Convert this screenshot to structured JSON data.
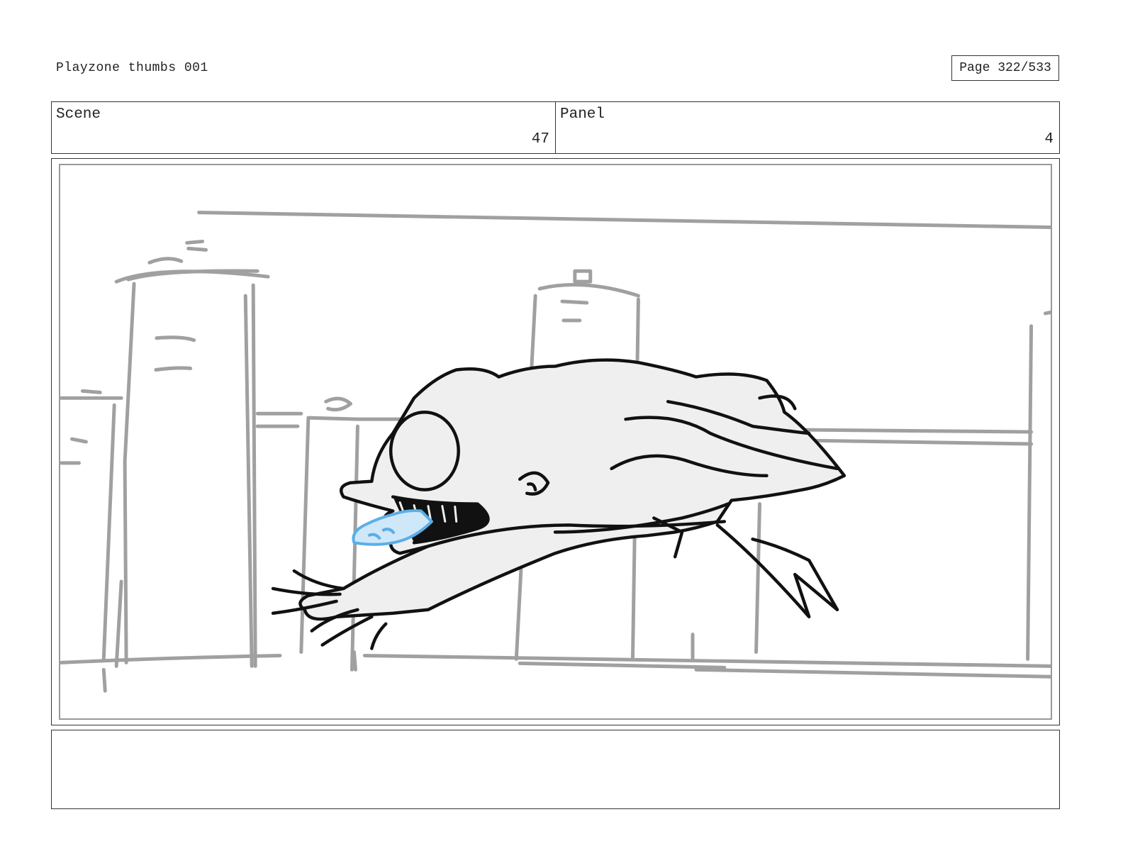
{
  "header": {
    "title": "Playzone thumbs 001",
    "page_label": "Page 322/533"
  },
  "info": {
    "scene_label": "Scene",
    "scene_value": "47",
    "panel_label": "Panel",
    "panel_value": "4"
  },
  "notes": {
    "text": ""
  },
  "colors": {
    "line": "#111111",
    "background_sketch": "#a0a0a0",
    "fill": "#efefef",
    "accent_blue": "#5aaee8"
  }
}
